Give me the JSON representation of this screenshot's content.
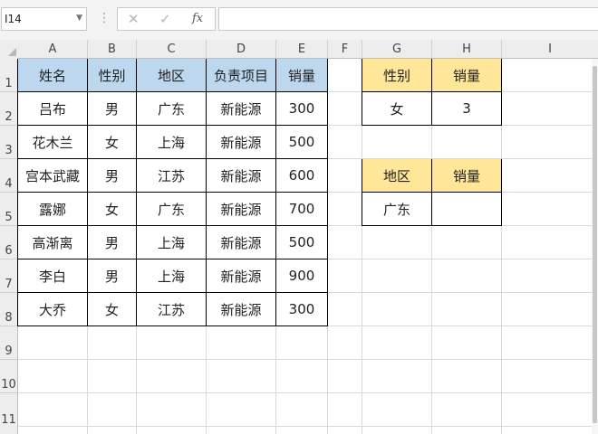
{
  "formula_bar": {
    "name_box": "I14",
    "cancel_glyph": "✕",
    "enter_glyph": "✓",
    "function_label": "fx",
    "formula": ""
  },
  "columns": [
    "A",
    "B",
    "C",
    "D",
    "E",
    "F",
    "G",
    "H",
    "I"
  ],
  "rows": [
    "1",
    "2",
    "3",
    "4",
    "5",
    "6",
    "7",
    "8",
    "9",
    "10",
    "11"
  ],
  "table": {
    "headers": [
      "姓名",
      "性别",
      "地区",
      "负责项目",
      "销量"
    ],
    "rows": [
      [
        "吕布",
        "男",
        "广东",
        "新能源",
        "300"
      ],
      [
        "花木兰",
        "女",
        "上海",
        "新能源",
        "500"
      ],
      [
        "宫本武藏",
        "男",
        "江苏",
        "新能源",
        "600"
      ],
      [
        "露娜",
        "女",
        "广东",
        "新能源",
        "700"
      ],
      [
        "高渐离",
        "男",
        "上海",
        "新能源",
        "500"
      ],
      [
        "李白",
        "男",
        "上海",
        "新能源",
        "900"
      ],
      [
        "大乔",
        "女",
        "江苏",
        "新能源",
        "300"
      ]
    ]
  },
  "lookup1": {
    "headers": [
      "性别",
      "销量"
    ],
    "values": [
      "女",
      "3"
    ]
  },
  "lookup2": {
    "headers": [
      "地区",
      "销量"
    ],
    "values": [
      "广东",
      ""
    ]
  },
  "colors": {
    "header_blue": "#bdd7ee",
    "header_gold": "#ffe699"
  }
}
